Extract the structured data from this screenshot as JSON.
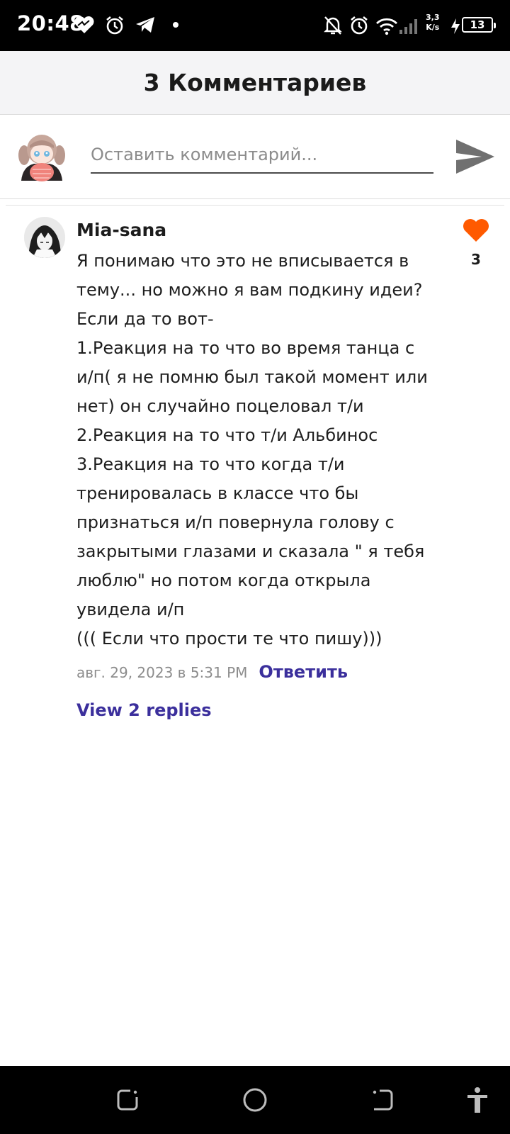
{
  "status_bar": {
    "time": "20:48",
    "net_speed_value": "3,3",
    "net_speed_unit": "K/s",
    "battery": "13",
    "icons": [
      "heart-icon",
      "alarm-icon",
      "telegram-icon",
      "dot-icon",
      "bell-off-icon",
      "alarm-icon",
      "wifi-icon",
      "signal-icon",
      "charging-icon"
    ]
  },
  "header": {
    "title": "3 Комментариев"
  },
  "compose": {
    "placeholder": "Оставить комментарий...",
    "value": ""
  },
  "comment": {
    "author": "Mia-sana",
    "lines": [
      "Я понимаю что это не вписывается в",
      "тему... но можно я вам подкину идеи?",
      "Если да то вот-",
      "1.Реакция на то что во время танца с",
      "и/п( я не помню был такой момент или",
      "нет) он случайно поцеловал т/и",
      "2.Реакция на то что т/и Альбинос",
      "3.Реакция на то что когда т/и",
      "тренировалась в классе что бы",
      "признаться и/п повернула голову с",
      "закрытыми глазами и сказала \" я тебя",
      "люблю\" но потом когда открыла",
      "увидела и/п",
      "((( Если что прости те что пишу)))"
    ],
    "date": "авг. 29, 2023 в 5:31 PM",
    "reply_label": "Ответить",
    "likes": "3",
    "view_replies": "View 2 replies"
  },
  "colors": {
    "accent": "#3b2f9c",
    "like": "#ff5a00",
    "header_bg": "#f4f4f6",
    "system_bar": "#000000"
  },
  "nav_bar": {
    "icons": [
      "recent-apps-icon",
      "home-icon",
      "back-icon",
      "accessibility-icon"
    ]
  }
}
